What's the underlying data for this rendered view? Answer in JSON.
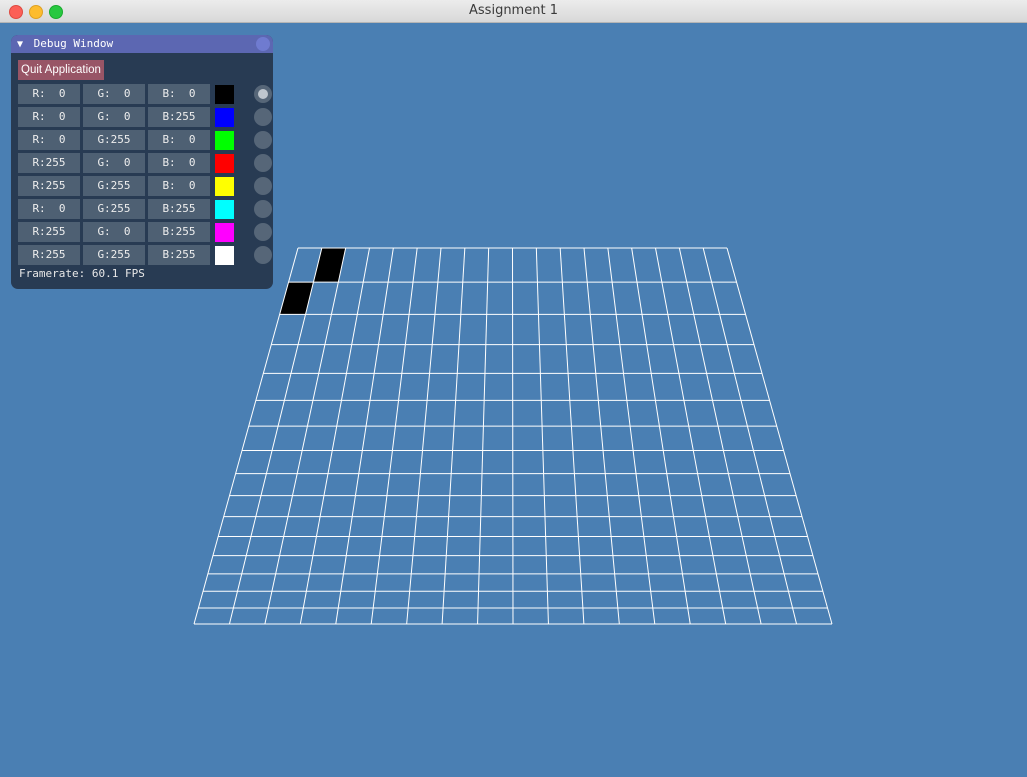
{
  "window": {
    "title": "Assignment 1"
  },
  "debug": {
    "title": "Debug Window",
    "quit_label": "Quit Application",
    "framerate": "Framerate: 60.1 FPS",
    "colors": [
      {
        "r": "R:  0",
        "g": "G:  0",
        "b": "B:  0",
        "hex": "#000000",
        "selected": true
      },
      {
        "r": "R:  0",
        "g": "G:  0",
        "b": "B:255",
        "hex": "#0000ff",
        "selected": false
      },
      {
        "r": "R:  0",
        "g": "G:255",
        "b": "B:  0",
        "hex": "#00ff00",
        "selected": false
      },
      {
        "r": "R:255",
        "g": "G:  0",
        "b": "B:  0",
        "hex": "#ff0000",
        "selected": false
      },
      {
        "r": "R:255",
        "g": "G:255",
        "b": "B:  0",
        "hex": "#ffff00",
        "selected": false
      },
      {
        "r": "R:  0",
        "g": "G:255",
        "b": "B:255",
        "hex": "#00ffff",
        "selected": false
      },
      {
        "r": "R:255",
        "g": "G:  0",
        "b": "B:255",
        "hex": "#ff00ff",
        "selected": false
      },
      {
        "r": "R:255",
        "g": "G:255",
        "b": "B:255",
        "hex": "#ffffff",
        "selected": false
      }
    ]
  },
  "canvas": {
    "background": "#4a7fb3",
    "grid_line_color": "#ffffff",
    "rows": 16,
    "cols": 18,
    "filled_cells": [
      {
        "row": 0,
        "col": 1,
        "color": "#000000"
      },
      {
        "row": 1,
        "col": 0,
        "color": "#000000"
      }
    ]
  }
}
